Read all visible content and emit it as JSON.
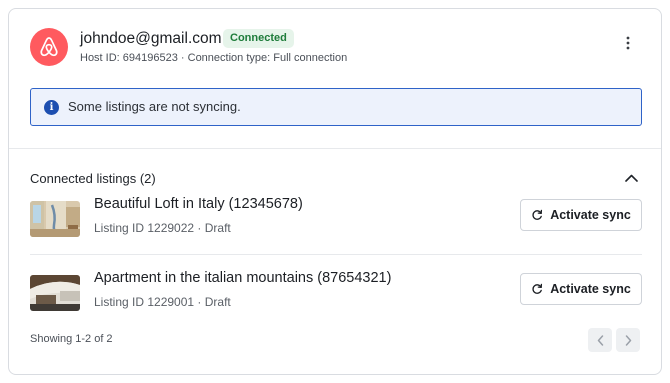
{
  "account": {
    "email": "johndoe@gmail.com",
    "status": "Connected",
    "host_info": "Host ID: 694196523 · Connection type: Full connection",
    "avatar_icon": "airbnb-logo-icon",
    "brand_color": "#ff5a5f",
    "more_icon": "more-vertical-icon"
  },
  "alert": {
    "icon": "info-icon",
    "text": "Some listings are not syncing."
  },
  "listings_section": {
    "title": "Connected listings (2)",
    "collapse_icon": "chevron-up-icon",
    "items": [
      {
        "title": "Beautiful Loft in Italy (12345678)",
        "meta": "Listing ID 1229022 · Draft",
        "action_label": "Activate sync",
        "action_icon": "refresh-icon"
      },
      {
        "title": "Apartment in the italian mountains (87654321)",
        "meta": "Listing ID 1229001 · Draft",
        "action_label": "Activate sync",
        "action_icon": "refresh-icon"
      }
    ]
  },
  "pagination": {
    "summary": "Showing 1-2 of 2",
    "prev_icon": "chevron-left-icon",
    "next_icon": "chevron-right-icon"
  }
}
